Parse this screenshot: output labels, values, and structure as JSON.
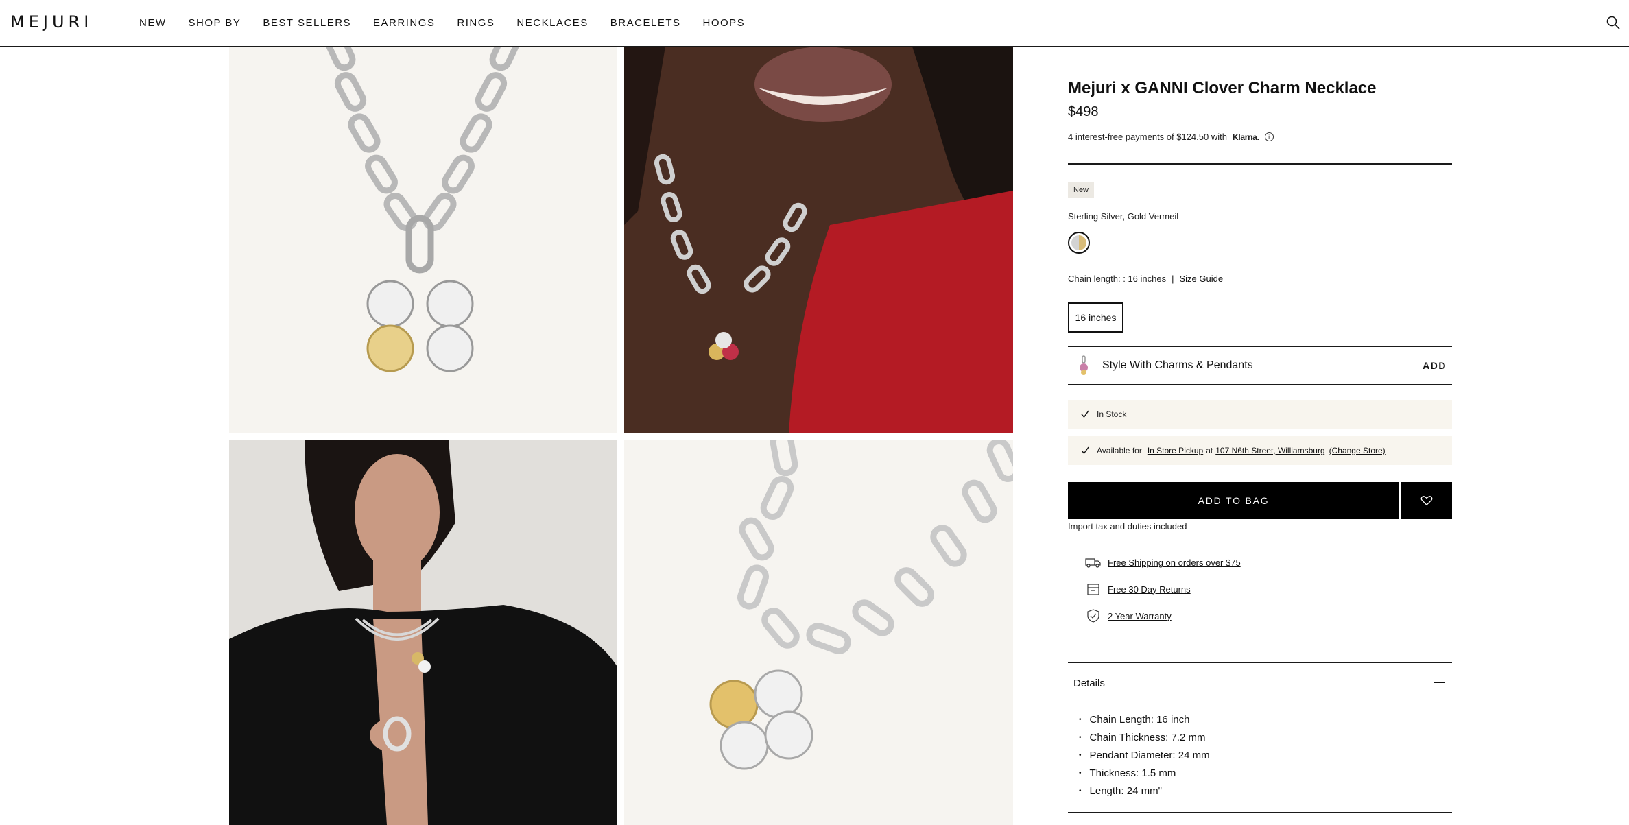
{
  "header": {
    "logo": "MEJURI",
    "nav": [
      "NEW",
      "SHOP BY",
      "BEST SELLERS",
      "EARRINGS",
      "RINGS",
      "NECKLACES",
      "BRACELETS",
      "HOOPS"
    ],
    "search_icon": "search-icon"
  },
  "product": {
    "title": "Mejuri x GANNI Clover Charm Necklace",
    "price": "$498",
    "klarna_text": "4 interest-free payments of $124.50 with",
    "klarna_brand": "Klarna.",
    "badge": "New",
    "material": "Sterling Silver, Gold Vermeil",
    "chain_length_label": "Chain length: : 16 inches",
    "chain_separator": "|",
    "size_guide": "Size Guide",
    "size_option": "16 inches",
    "style_with": "Style With Charms & Pendants",
    "style_add": "ADD",
    "in_stock": "In Stock",
    "pickup_prefix": "Available for",
    "pickup_link": "In Store Pickup",
    "pickup_at": "at",
    "pickup_store": "107 N6th Street, Williamsburg",
    "pickup_change": "(Change Store)",
    "add_to_bag": "ADD TO BAG",
    "tax_note": "Import tax and duties included",
    "perks": {
      "shipping": "Free Shipping on orders over $75",
      "returns": "Free 30 Day Returns",
      "warranty": "2 Year Warranty"
    },
    "details_title": "Details",
    "details": [
      "Chain Length: 16 inch",
      "Chain Thickness: 7.2 mm",
      "Pendant Diameter: 24 mm",
      "Thickness: 1.5 mm",
      "Length: 24 mm\""
    ]
  },
  "colors": {
    "brand_black": "#000000",
    "status_bg": "#f8f5ee",
    "badge_bg": "#ece9e3"
  }
}
